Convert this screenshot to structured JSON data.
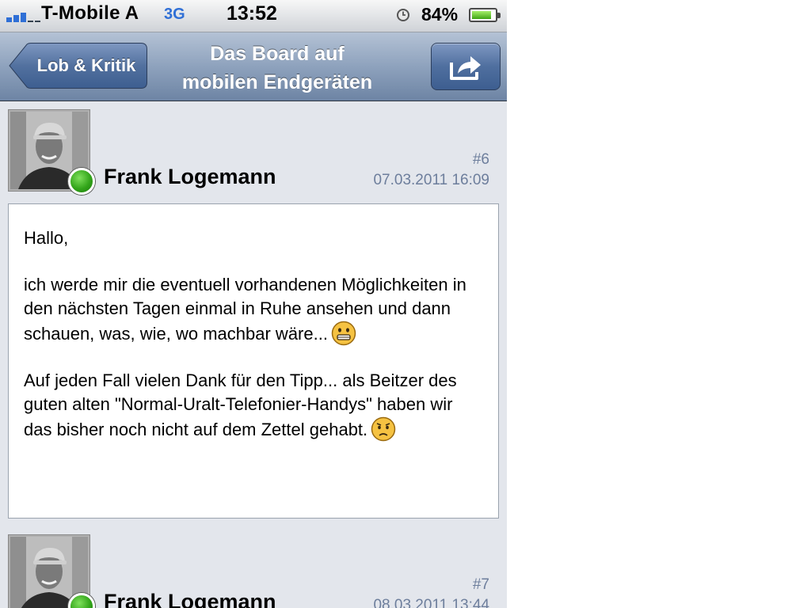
{
  "status_bar": {
    "carrier": "T-Mobile A",
    "network": "3G",
    "time": "13:52",
    "battery_percent": "84%",
    "battery_level": 0.84,
    "signal_bars": 3,
    "icons": [
      "signal-icon",
      "alarm-icon",
      "battery-icon"
    ]
  },
  "nav": {
    "back_label": "Lob & Kritik",
    "title_line1": "Das Board auf",
    "title_line2": "mobilen Endgeräten",
    "share_icon": "share-icon"
  },
  "posts": [
    {
      "author": "Frank Logemann",
      "number": "#6",
      "date": "07.03.2011 16:09",
      "online": true,
      "paragraphs": [
        "Hallo,",
        "ich werde mir die eventuell vorhandenen Möglichkeiten in den nächsten Tagen einmal in Ruhe ansehen und dann schauen, was, wie, wo machbar wäre...",
        "Auf jeden Fall vielen Dank für den Tipp... als Beitzer des guten alten \"Normal-Uralt-Telefonier-Handys\" haben wir das bisher noch nicht auf dem Zettel gehabt."
      ],
      "smileys": [
        "grin-smiley-icon",
        "worried-smiley-icon"
      ]
    },
    {
      "author": "Frank Logemann",
      "number": "#7",
      "date": "08.03.2011 13:44",
      "online": true
    }
  ],
  "colors": {
    "nav_blue": "#6d84a4",
    "meta_text": "#6d7e9c",
    "online_green": "#33a51a",
    "background": "#e3e6ec"
  }
}
